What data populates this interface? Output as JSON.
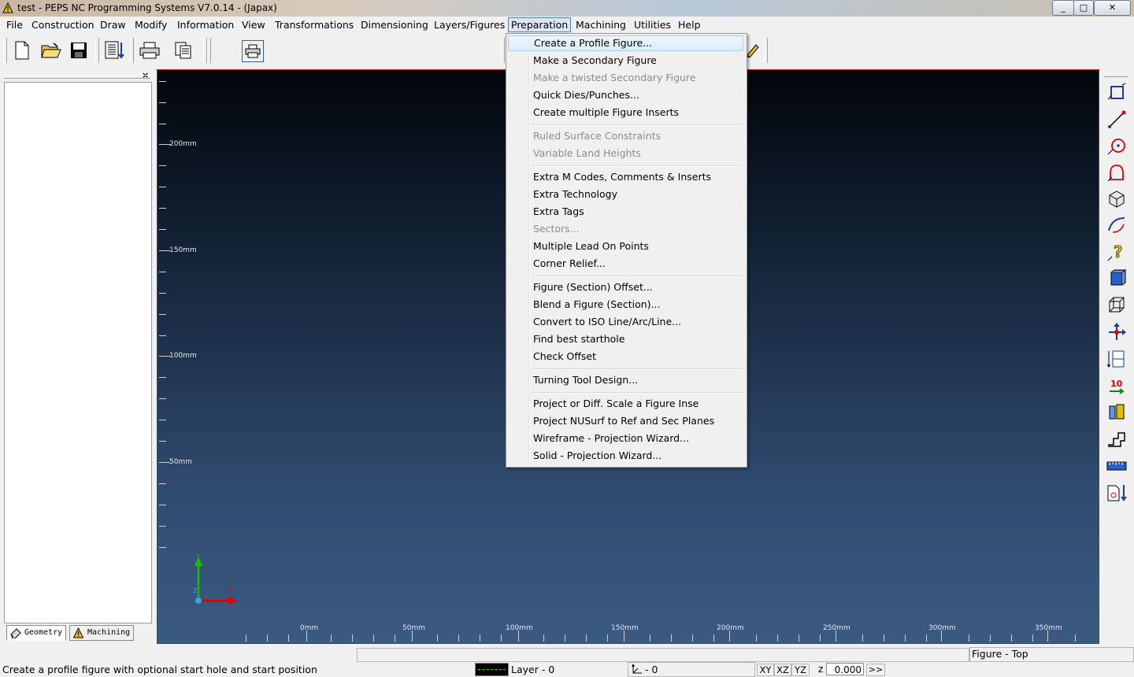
{
  "window": {
    "title": "test - PEPS NC Programming Systems V7.0.14 - (Japax)",
    "minimize": "_",
    "maximize": "□",
    "close": "✕"
  },
  "menubar": {
    "items": [
      "File",
      "Construction",
      "Draw",
      "Modify",
      "Information",
      "View",
      "Transformations",
      "Dimensioning",
      "Layers/Figures",
      "Preparation",
      "Machining",
      "Utilities",
      "Help"
    ],
    "active": "Preparation"
  },
  "toolbar": {
    "buttons": [
      "new-file-icon",
      "open-folder-icon",
      "save-icon",
      "sheet-list-icon",
      "print-icon",
      "copy-pages-icon",
      "print-preview-icon"
    ]
  },
  "left_panel": {
    "close": "×",
    "tabs": [
      "Geometry",
      "Machining"
    ],
    "selected_tab": "Geometry"
  },
  "canvas": {
    "y_labels": [
      "200mm",
      "150mm",
      "100mm",
      "50mm"
    ],
    "x_labels": [
      "0mm",
      "50mm",
      "100mm",
      "150mm",
      "200mm",
      "250mm",
      "300mm",
      "350mm"
    ],
    "axis_x_label": "X",
    "axis_y_label": "Y",
    "axis_z_label": "Z",
    "colors": {
      "top": "#03060b",
      "bottom": "#3b5a82",
      "border": "#c01818"
    }
  },
  "dropdown": {
    "menu": "Preparation",
    "items": [
      {
        "label": "Create a Profile Figure...",
        "state": "hover"
      },
      {
        "label": "Make a Secondary Figure",
        "state": "enabled"
      },
      {
        "label": "Make a twisted Secondary Figure",
        "state": "disabled"
      },
      {
        "label": "Quick Dies/Punches...",
        "state": "enabled"
      },
      {
        "label": "Create multiple Figure Inserts",
        "state": "enabled"
      },
      {
        "label": "Ruled Surface Constraints",
        "state": "disabled"
      },
      {
        "label": "Variable Land Heights",
        "state": "disabled"
      },
      {
        "label": "Extra M Codes, Comments & Inserts",
        "state": "enabled"
      },
      {
        "label": "Extra Technology",
        "state": "enabled"
      },
      {
        "label": "Extra Tags",
        "state": "enabled"
      },
      {
        "label": "Sectors...",
        "state": "disabled"
      },
      {
        "label": "Multiple Lead On Points",
        "state": "enabled"
      },
      {
        "label": "Corner Relief...",
        "state": "enabled"
      },
      {
        "label": "Figure (Section) Offset...",
        "state": "enabled"
      },
      {
        "label": "Blend a Figure (Section)...",
        "state": "enabled"
      },
      {
        "label": "Convert to ISO Line/Arc/Line...",
        "state": "enabled"
      },
      {
        "label": "Find best starthole",
        "state": "enabled"
      },
      {
        "label": "Check Offset",
        "state": "enabled"
      },
      {
        "label": "Turning Tool Design...",
        "state": "enabled"
      },
      {
        "label": "Project or Diff. Scale a Figure Inse",
        "state": "enabled"
      },
      {
        "label": "Project NUSurf to Ref and Sec Planes",
        "state": "enabled"
      },
      {
        "label": "Wireframe - Projection Wizard...",
        "state": "enabled"
      },
      {
        "label": "Solid - Projection Wizard...",
        "state": "enabled"
      }
    ]
  },
  "right_toolbar": {
    "icons": [
      "rectangle-select-icon",
      "line-tool-icon",
      "circle-tool-icon",
      "profile-tool-icon",
      "cube-tool-icon",
      "arc-curve-icon",
      "help-query-icon",
      "solid-view-icon",
      "wireframe-cube-icon",
      "move-arrows-icon",
      "step-list-icon",
      "number-ten-icon",
      "tool-holder-icon",
      "path-shape-icon",
      "ruler-icon",
      "page-down-icon"
    ]
  },
  "statusbar": {
    "message": "Create a profile figure with optional start hole and start position",
    "layer": "Layer - 0",
    "coord_sys": "- 0",
    "plane_buttons": [
      "XY",
      "XZ",
      "YZ"
    ],
    "z_label": "z",
    "z_value": "0.000",
    "next_button": ">>",
    "view_label": "Figure - Top"
  }
}
